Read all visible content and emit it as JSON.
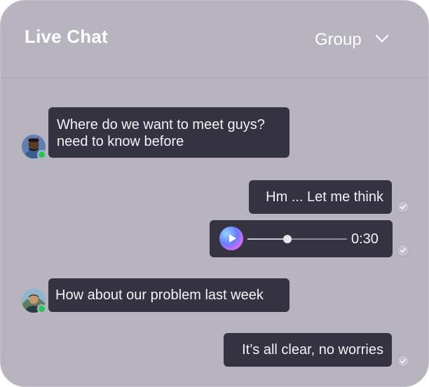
{
  "header": {
    "title": "Live Chat",
    "group_selector": {
      "selected": "Group"
    }
  },
  "colors": {
    "panel_bg": "#b7b4bf",
    "bubble_bg": "#35333f",
    "online": "#22c55e"
  },
  "messages": [
    {
      "side": "incoming",
      "avatar": "user-avatar-1",
      "online": true,
      "line1": "Where do we want to meet guys?",
      "line2": "need to know before"
    },
    {
      "side": "outgoing",
      "text": "Hm ... Let me think",
      "read": true
    },
    {
      "side": "outgoing",
      "type": "voice",
      "duration": "0:30",
      "progress": 0.4,
      "read": true
    },
    {
      "side": "incoming",
      "avatar": "user-avatar-2",
      "online": true,
      "text": "How about our problem last week"
    },
    {
      "side": "outgoing",
      "text": "It’s all clear, no worries",
      "read": true
    }
  ]
}
